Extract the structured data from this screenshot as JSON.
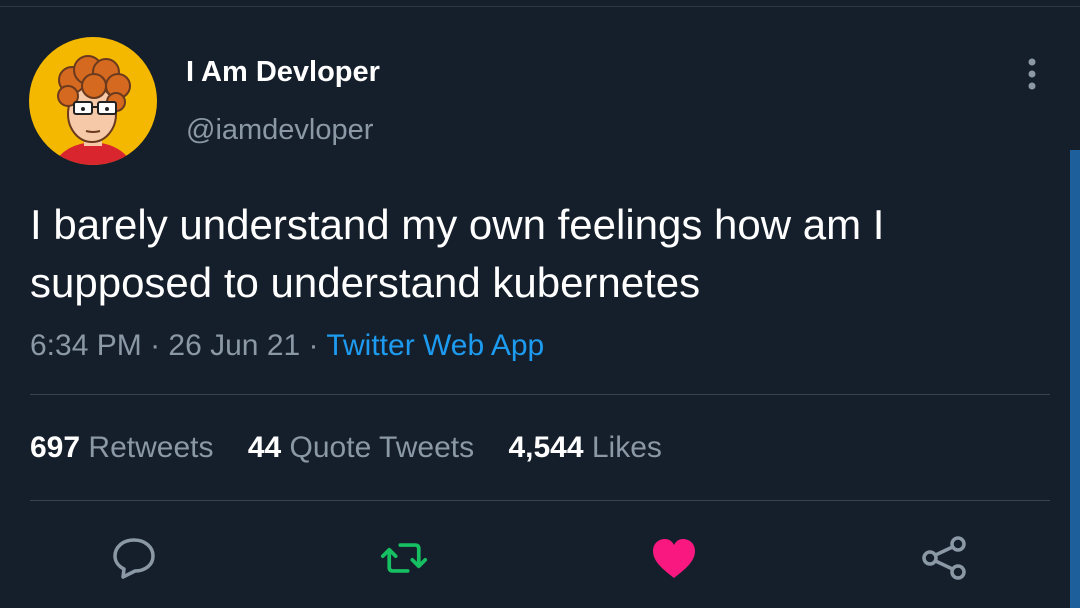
{
  "tweet": {
    "author": {
      "display_name": "I Am Devloper",
      "handle": "@iamdevloper"
    },
    "text": "I barely understand my own feelings how am I supposed to understand kubernetes",
    "time": "6:34 PM",
    "date": "26 Jun 21",
    "separator": "·",
    "source": "Twitter Web App"
  },
  "stats": {
    "retweets": {
      "count": "697",
      "label": "Retweets"
    },
    "quote_tweets": {
      "count": "44",
      "label": "Quote Tweets"
    },
    "likes": {
      "count": "4,544",
      "label": "Likes"
    }
  },
  "actions": {
    "reply_icon": "reply-icon",
    "retweet_icon": "retweet-icon",
    "like_icon": "heart-icon",
    "share_icon": "share-icon"
  },
  "colors": {
    "background": "#151f2b",
    "link": "#1d9bf0",
    "retweet_active": "#17bf63",
    "like_active": "#f91880",
    "secondary_text": "#8b98a5"
  }
}
